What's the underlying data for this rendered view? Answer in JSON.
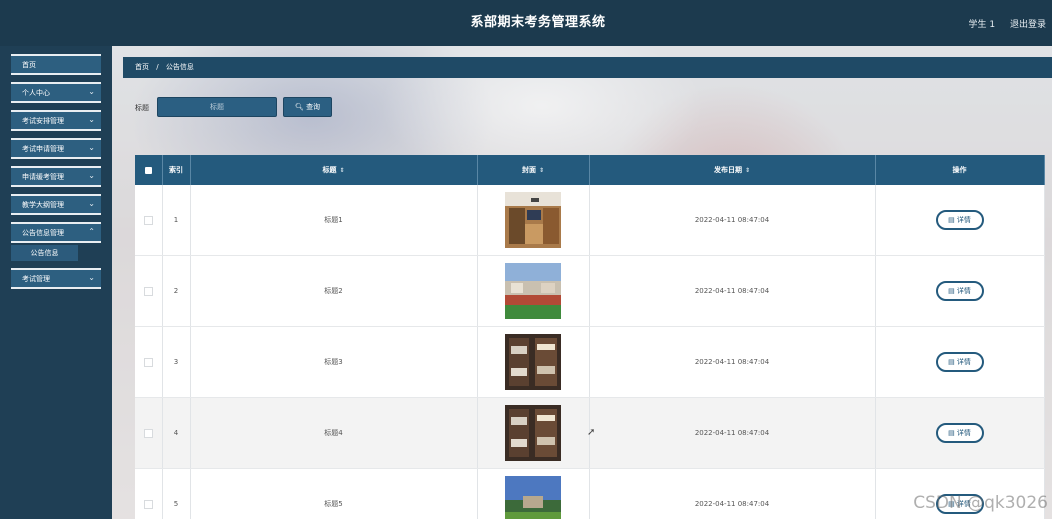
{
  "header": {
    "title": "系部期末考务管理系统",
    "user": "学生 1",
    "logout": "退出登录"
  },
  "sidebar": {
    "items": [
      {
        "label": "首页",
        "has_children": false
      },
      {
        "label": "个人中心",
        "has_children": true
      },
      {
        "label": "考试安排管理",
        "has_children": true
      },
      {
        "label": "考试申请管理",
        "has_children": true
      },
      {
        "label": "申请缓考管理",
        "has_children": true
      },
      {
        "label": "教学大纲管理",
        "has_children": true
      },
      {
        "label": "公告信息管理",
        "has_children": true,
        "expanded": true
      },
      {
        "label": "考试管理",
        "has_children": true
      }
    ],
    "active_sub_item": "公告信息"
  },
  "breadcrumb": {
    "home": "首页",
    "separator": "/",
    "current": "公告信息"
  },
  "search": {
    "label": "标题",
    "placeholder": "标题",
    "button": "查询",
    "button_icon": "search-icon"
  },
  "table": {
    "columns": [
      "索引",
      "标题",
      "封面",
      "发布日期",
      "操作"
    ],
    "rows": [
      {
        "index": "1",
        "title": "标题1",
        "cover": "dormitory-room",
        "date": "2022-04-11 08:47:04",
        "action": "详情"
      },
      {
        "index": "2",
        "title": "标题2",
        "cover": "sports-field",
        "date": "2022-04-11 08:47:04",
        "action": "详情"
      },
      {
        "index": "3",
        "title": "标题3",
        "cover": "bunk-beds",
        "date": "2022-04-11 08:47:04",
        "action": "详情"
      },
      {
        "index": "4",
        "title": "标题4",
        "cover": "bunk-beds",
        "date": "2022-04-11 08:47:04",
        "action": "详情"
      },
      {
        "index": "5",
        "title": "标题5",
        "cover": "campus-lawn",
        "date": "2022-04-11 08:47:04",
        "action": "详情"
      }
    ]
  },
  "watermark": "CSDN @qk3026",
  "colors": {
    "header_bg": "#1c3a4e",
    "sidebar_bg": "#1f3f55",
    "accent": "#245a7d"
  }
}
